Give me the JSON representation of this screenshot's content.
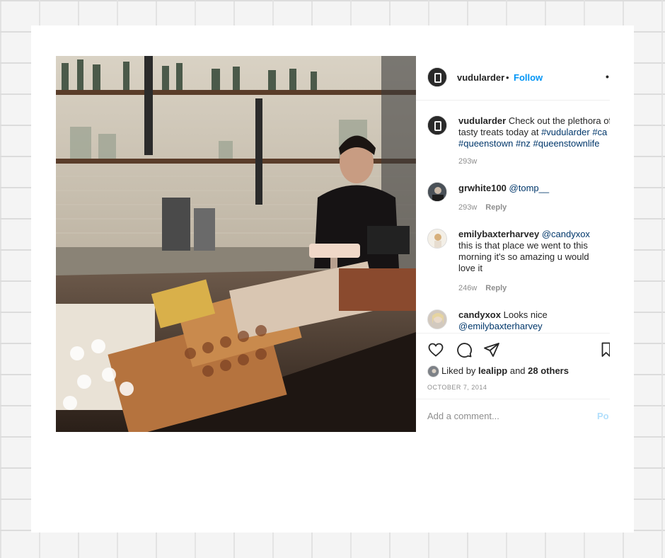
{
  "post": {
    "username": "vudularder",
    "dot": "•",
    "follow_label": "Follow",
    "more": "•"
  },
  "caption": {
    "username": "vudularder",
    "line1_text": "Check out the plethora of",
    "line2_text": "tasty treats today at ",
    "line2_tag1": "#vudularder",
    "line2_tag2": " #ca",
    "line3_tags": "#queenstown #nz #queenstownlife",
    "age": "293w"
  },
  "comments": [
    {
      "username": "grwhite100",
      "text": "@tomp__",
      "age": "293w",
      "reply": "Reply"
    },
    {
      "username": "emilybaxterharvey",
      "mention": "@candyxox",
      "line2": "this is that place we went to this",
      "line3": "morning it's so amazing u would",
      "line4": "love it",
      "age": "246w",
      "reply": "Reply"
    },
    {
      "username": "candyxox",
      "text": "Looks nice",
      "mention": "@emilybaxterharvey"
    }
  ],
  "actions": {
    "like_icon": "heart-icon",
    "comment_icon": "comment-icon",
    "share_icon": "paper-plane-icon",
    "save_icon": "bookmark-icon"
  },
  "likes": {
    "prefix": "Liked by ",
    "user": "lealipp",
    "and": " and ",
    "others": "28 others"
  },
  "date": "OCTOBER 7, 2014",
  "add_comment": {
    "placeholder": "Add a comment...",
    "post_label": "Po"
  },
  "colors": {
    "link_blue": "#0095f6",
    "hashtag": "#00376b",
    "muted": "#8e8e8e",
    "text": "#262626"
  }
}
